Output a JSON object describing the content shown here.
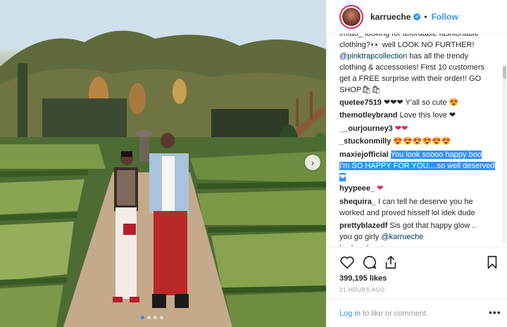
{
  "header": {
    "username": "karrueche",
    "verified_mark": "✔",
    "follow_label": "Follow",
    "separator": "•"
  },
  "caption": {
    "line1": "lmfao_ looking for affordable fashionable",
    "line2_text": "clothing?👀 well LOOK NO FURTHER!",
    "line3_mention": "@pinktrapcollection",
    "line3_text": " has all the trendy",
    "line4": "clothing & accessories! First 10 customers",
    "line5": "get a FREE surprise with their order!! GO",
    "line6": "SHOP🛍🛍"
  },
  "comments": [
    {
      "user": "quetee7519",
      "text": "❤❤❤ Y'all so cute 😍"
    },
    {
      "user": "themotleybrand",
      "text": "Love this love ❤"
    },
    {
      "user": "__ourjourney3",
      "text": "❤❤"
    },
    {
      "user": "_stuckonmilly",
      "text": "😍😍😍😍😍😍"
    },
    {
      "user": "maxiejofficial",
      "line1": "You look soooo happy boo",
      "line2": "I'm SO HAPPY FOR YOU....so well deserved",
      "line3": "❤"
    },
    {
      "user": "hyypeee_",
      "text": "❤"
    },
    {
      "user": "shequira_",
      "line1": "I can tell he deserve you he",
      "line2": "worked and proved hisself lol idek dude"
    },
    {
      "user": "prettyblazedf",
      "line1": "Sis got that happy glow ..",
      "line2_text": "you go girly ",
      "line2_mention": "@karrueche"
    },
    {
      "user": "itsdrewhunter",
      "text": "❤❤"
    }
  ],
  "post": {
    "likes": "399,195 likes",
    "time": "21 HOURS AGO"
  },
  "footer": {
    "login_link": "Log in",
    "login_rest": " to like or comment.",
    "more": "•••"
  },
  "icons": {
    "like": "heart-outline-icon",
    "comment": "comment-bubble-icon",
    "share": "share-icon",
    "save": "bookmark-icon",
    "next": "chevron-right-icon"
  },
  "colors": {
    "accent": "#3897f0",
    "heart": "#e0245e",
    "selection": "#3390ff"
  }
}
